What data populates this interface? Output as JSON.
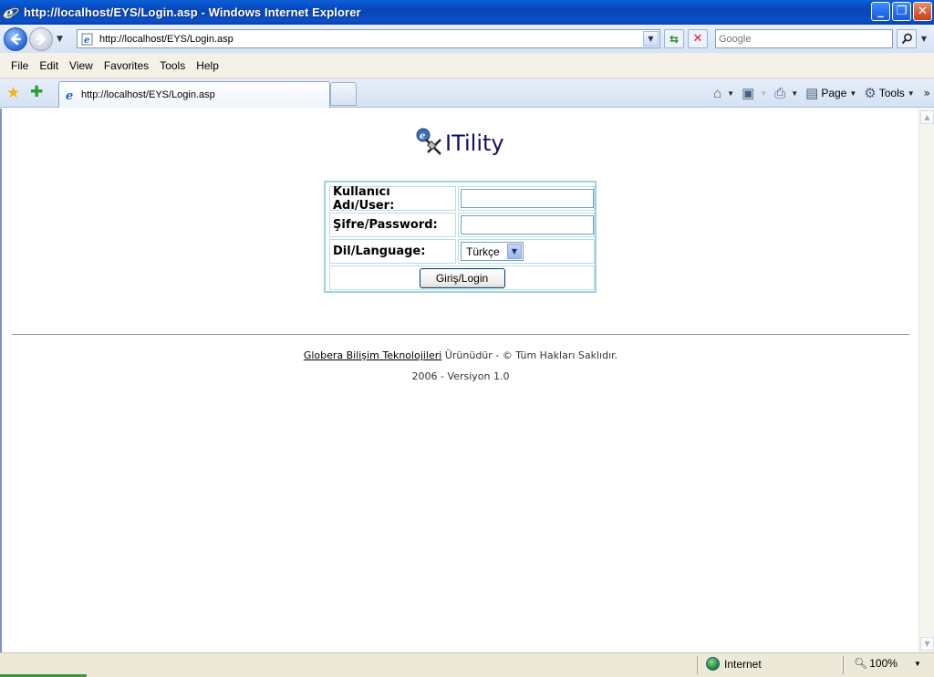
{
  "window": {
    "title": "http://localhost/EYS/Login.asp - Windows Internet Explorer",
    "minimize_glyph": "_",
    "maximize_glyph": "❐",
    "close_glyph": "✕"
  },
  "address_bar": {
    "url": "http://localhost/EYS/Login.asp",
    "search_placeholder": "Google"
  },
  "menu": [
    "File",
    "Edit",
    "View",
    "Favorites",
    "Tools",
    "Help"
  ],
  "tab": {
    "label": "http://localhost/EYS/Login.asp"
  },
  "command_bar": {
    "page_label": "Page",
    "tools_label": "Tools"
  },
  "page": {
    "logo_text": "ITility",
    "form": {
      "user_label": "Kullanıcı Adı/User:",
      "password_label": "Şifre/Password:",
      "language_label": "Dil/Language:",
      "language_value": "Türkçe",
      "login_button": "Giriş/Login"
    },
    "footer": {
      "company_link": "Globera Bilişim Teknolojileri",
      "rights_text": " Ürünüdür - © Tüm Hakları Saklıdır.",
      "version_text": "2006 - Versiyon 1.0"
    }
  },
  "status_bar": {
    "zone": "Internet",
    "zoom": "100%"
  },
  "colors": {
    "titlebar": "#0a4fc9",
    "login_border": "#9fd3de",
    "logo_text": "#101060"
  }
}
